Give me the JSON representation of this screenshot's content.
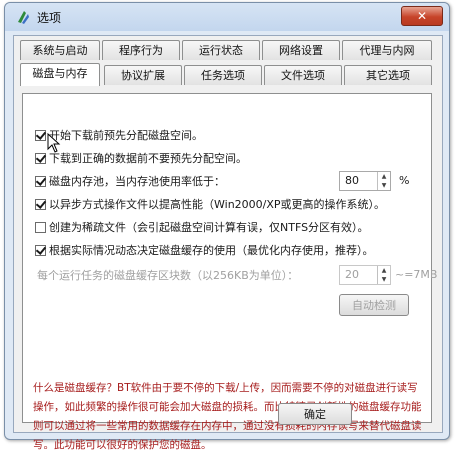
{
  "window": {
    "title": "选项",
    "close_glyph": "✕"
  },
  "tabs_row1": [
    {
      "label": "系统与启动"
    },
    {
      "label": "程序行为"
    },
    {
      "label": "运行状态"
    },
    {
      "label": "网络设置"
    },
    {
      "label": "代理与内网"
    }
  ],
  "tabs_row2": [
    {
      "label": "磁盘与内存",
      "active": true
    },
    {
      "label": "协议扩展"
    },
    {
      "label": "任务选项"
    },
    {
      "label": "文件选项"
    },
    {
      "label": "其它选项"
    }
  ],
  "options": [
    {
      "label": "开始下载前预先分配磁盘空间。",
      "checked": true
    },
    {
      "label": "下载到正确的数据前不要预先分配空间。",
      "checked": true
    },
    {
      "label": "磁盘内存池，当内存池使用率低于：",
      "checked": true,
      "spin_value": "80",
      "unit": "%"
    },
    {
      "label": "以异步方式操作文件以提高性能（Win2000/XP或更高的操作系统）。",
      "checked": true
    },
    {
      "label": "创建为稀疏文件（会引起磁盘空间计算有误，仅NTFS分区有效）。",
      "checked": false
    },
    {
      "label": "根据实际情况动态决定磁盘缓存的使用（最优化内存使用，推荐）。",
      "checked": true
    }
  ],
  "cache_row": {
    "label": "每个运行任务的磁盘缓存区块数（以256KB为单位）：",
    "value": "20",
    "approx": "~=7MB"
  },
  "auto_detect_button": "自动检测",
  "info_text": "什么是磁盘缓存？BT软件由于要不停的下载/上传，因而需要不停的对磁盘进行读写操作，如此频繁的操作很可能会加大磁盘的损耗。而比特精灵创新性的磁盘缓存功能则可以通过将一些常用的数据缓存在内存中，通过没有损耗的内存读写来替代磁盘读写。此功能可以很好的保护您的磁盘。",
  "ok_button": "确定",
  "colors": {
    "info_text": "#a61c1c",
    "title_bar": "#c3d6ee",
    "close_button": "#c7442a"
  },
  "icons": {
    "app": "app-logo-icon",
    "close": "close-icon",
    "cursor": "mouse-pointer-icon"
  }
}
